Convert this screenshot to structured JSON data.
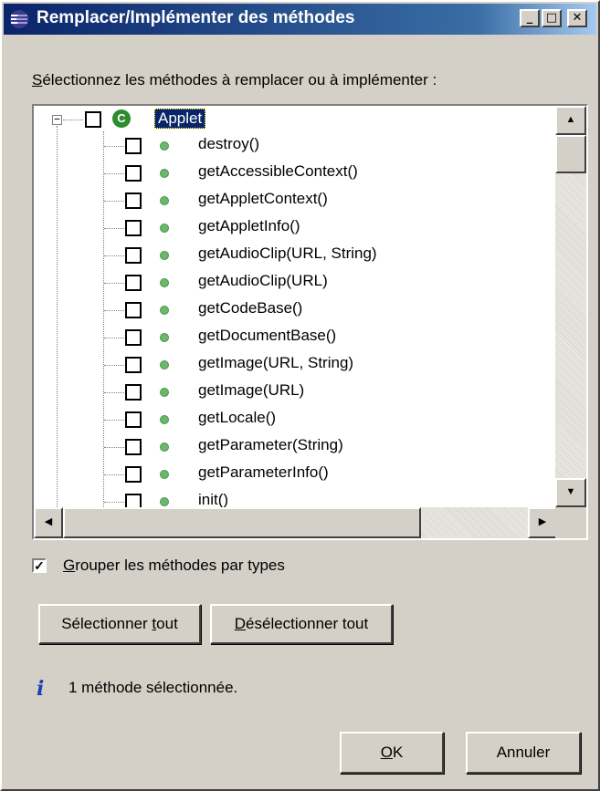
{
  "window": {
    "title": "Remplacer/Implémenter des méthodes",
    "minimize": "_",
    "maximize": "□",
    "close": "✕"
  },
  "instruction": {
    "mnemonic": "S",
    "rest": "électionnez les méthodes à remplacer ou à implémenter :"
  },
  "tree": {
    "root": {
      "label": "Applet",
      "icon": "class-c-icon",
      "checked": false,
      "expanded": true
    },
    "methods": [
      "destroy()",
      "getAccessibleContext()",
      "getAppletContext()",
      "getAppletInfo()",
      "getAudioClip(URL, String)",
      "getAudioClip(URL)",
      "getCodeBase()",
      "getDocumentBase()",
      "getImage(URL, String)",
      "getImage(URL)",
      "getLocale()",
      "getParameter(String)",
      "getParameterInfo()",
      "init()"
    ]
  },
  "group_by_types": {
    "checked": true,
    "mnemonic": "G",
    "rest": "rouper les méthodes par types"
  },
  "buttons": {
    "select_all_a": "Sélectionner ",
    "select_all_mn": "t",
    "select_all_b": "out",
    "deselect_all_mn": "D",
    "deselect_all_rest": "ésélectionner tout",
    "ok_mn": "O",
    "ok_rest": "K",
    "cancel": "Annuler"
  },
  "status": {
    "icon": "info-icon",
    "text": "1 méthode sélectionnée."
  },
  "colors": {
    "titlebar_start": "#0a246a",
    "titlebar_end": "#a6caf0",
    "dialog_bg": "#d4d0c8",
    "class_icon": "#2e8b2e",
    "method_icon": "#6bb86b",
    "selection": "#0a246a"
  }
}
